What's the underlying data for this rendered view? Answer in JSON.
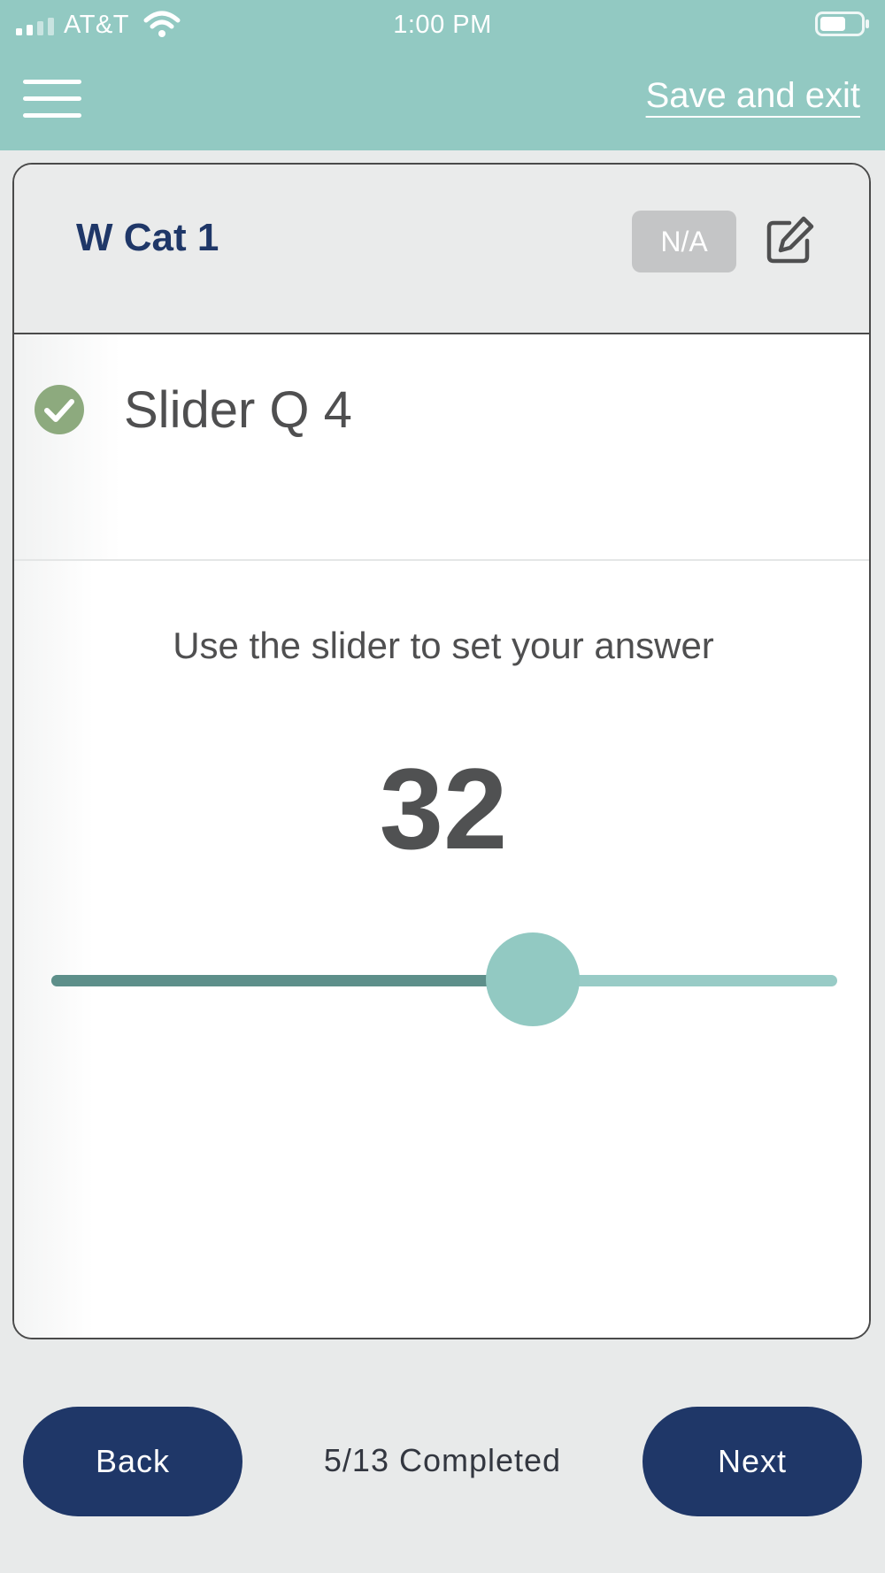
{
  "status_bar": {
    "carrier": "AT&T",
    "time": "1:00 PM",
    "icons": [
      "signal-icon",
      "wifi-icon",
      "battery-icon"
    ]
  },
  "header": {
    "menu_icon": "hamburger-menu-icon",
    "save_exit_label": "Save and exit"
  },
  "card": {
    "category_title": "W Cat 1",
    "na_label": "N/A",
    "edit_icon": "edit-icon",
    "question": {
      "status_icon": "check-circle-icon",
      "title": "Slider Q 4"
    },
    "instructions": "Use the slider to set your answer",
    "slider": {
      "value": "32",
      "fraction": 0.613
    }
  },
  "footer": {
    "back_label": "Back",
    "progress": "5/13 Completed",
    "next_label": "Next"
  },
  "colors": {
    "header_bg": "#92c9c2",
    "accent_dark": "#1f3768",
    "slider_fill": "#5d8f8a",
    "slider_track": "#98cbc6",
    "check_green": "#8daa7e"
  }
}
